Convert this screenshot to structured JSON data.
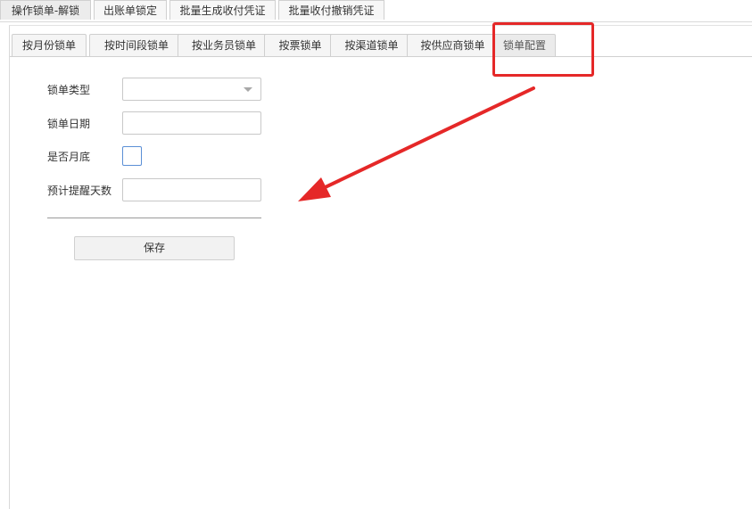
{
  "top_tabs": [
    {
      "label": "操作锁单-解锁",
      "active": true
    },
    {
      "label": "出账单锁定",
      "active": false
    },
    {
      "label": "批量生成收付凭证",
      "active": false
    },
    {
      "label": "批量收付撤销凭证",
      "active": false
    }
  ],
  "sub_tabs": [
    {
      "label": "按月份锁单",
      "active": false
    },
    {
      "label": "按时间段锁单",
      "active": false
    },
    {
      "label": "按业务员锁单",
      "active": false
    },
    {
      "label": "按票锁单",
      "active": false
    },
    {
      "label": "按渠道锁单",
      "active": false
    },
    {
      "label": "按供应商锁单",
      "active": false
    },
    {
      "label": "锁单配置",
      "active": true
    }
  ],
  "form": {
    "lock_type_label": "锁单类型",
    "lock_type_value": "",
    "lock_date_label": "锁单日期",
    "lock_date_value": "",
    "month_end_label": "是否月底",
    "month_end_checked": false,
    "remind_days_label": "预计提醒天数",
    "remind_days_value": ""
  },
  "save_label": "保存",
  "annotation": {
    "color": "#e52828",
    "icon": "red-arrow-icon"
  }
}
